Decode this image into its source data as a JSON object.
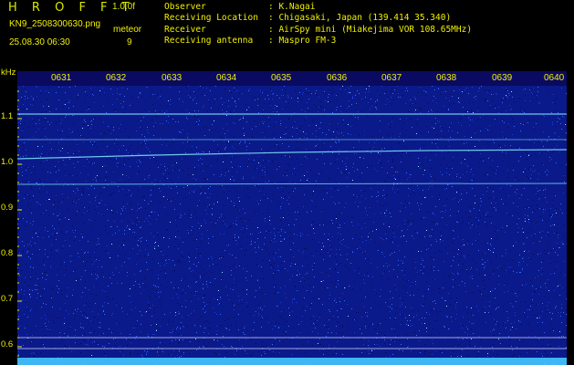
{
  "header": {
    "brand": "H R O F F T",
    "version": "1.0.0f",
    "filename": "KN9_2508300630.png",
    "datetime": "25.08.30 06:30",
    "meteor_label": "meteor",
    "meteor_count": "9",
    "info": [
      {
        "key": "Observer",
        "value": ": K.Nagai"
      },
      {
        "key": "Receiving Location",
        "value": ": Chigasaki, Japan (139.414 35.340)"
      },
      {
        "key": "Receiver",
        "value": ": AirSpy mini (Miakejima VOR 108.65MHz)"
      },
      {
        "key": "Receiving antenna",
        "value": ": Maspro FM-3"
      }
    ]
  },
  "axis": {
    "unit": "kHz",
    "y_ticks": [
      "1.1",
      "1.0",
      "0.9",
      "0.8",
      "0.7",
      "0.6"
    ],
    "time_ticks": [
      "0631",
      "0632",
      "0633",
      "0634",
      "0635",
      "0636",
      "0637",
      "0638",
      "0639",
      "0640"
    ]
  },
  "colors": {
    "label": "#f0f000",
    "spectrogram_bg": "#0b1a8a",
    "trace": "#7fe7ff"
  }
}
